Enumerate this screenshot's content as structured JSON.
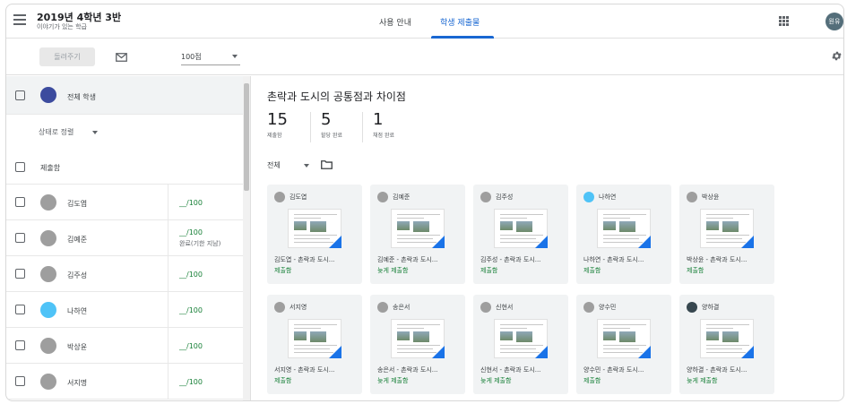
{
  "header": {
    "class_title": "2019년 4학년 3반",
    "class_subtitle": "이야기가 있는 학급",
    "tabs": [
      {
        "label": "사용 안내"
      },
      {
        "label": "학생 제출물"
      }
    ],
    "user_avatar": "원유"
  },
  "toolbar": {
    "return_label": "돌려주기",
    "points_value": "100점"
  },
  "left": {
    "all_students_label": "전체 학생",
    "sort_label": "상태로 정렬",
    "submitted_section_label": "제출함",
    "students": [
      {
        "name": "김도엽",
        "grade": "__/100",
        "note": ""
      },
      {
        "name": "김예준",
        "grade": "__/100",
        "note": "완료(기한 지남)"
      },
      {
        "name": "김주성",
        "grade": "__/100",
        "note": ""
      },
      {
        "name": "나하연",
        "grade": "__/100",
        "note": ""
      },
      {
        "name": "박상윤",
        "grade": "__/100",
        "note": ""
      },
      {
        "name": "서지명",
        "grade": "__/100",
        "note": ""
      }
    ]
  },
  "main": {
    "assignment_title": "촌락과 도시의 공통점과 차이점",
    "stats": [
      {
        "num": "15",
        "label": "제출함"
      },
      {
        "num": "5",
        "label": "할당 완료"
      },
      {
        "num": "1",
        "label": "채점 완료"
      }
    ],
    "filter_label": "전체",
    "cards": [
      {
        "name": "김도엽",
        "file": "김도엽 - 촌락과 도시...",
        "status": "제출함"
      },
      {
        "name": "김예준",
        "file": "김예준 - 촌락과 도시...",
        "status": "늦게 제출함"
      },
      {
        "name": "김주성",
        "file": "김주성 - 촌락과 도시...",
        "status": "제출함"
      },
      {
        "name": "나하연",
        "file": "나하연 - 촌락과 도시...",
        "status": "제출함"
      },
      {
        "name": "박상윤",
        "file": "박상윤 - 촌락과 도시...",
        "status": "제출함"
      },
      {
        "name": "서지영",
        "file": "서지영 - 촌락과 도시...",
        "status": "제출함"
      },
      {
        "name": "송은서",
        "file": "송은서 - 촌락과 도시...",
        "status": "늦게 제출함"
      },
      {
        "name": "신현서",
        "file": "신현서 - 촌락과 도시...",
        "status": "늦게 제출함"
      },
      {
        "name": "양수민",
        "file": "양수민 - 촌락과 도시...",
        "status": "제출함"
      },
      {
        "name": "양하결",
        "file": "양하결 - 촌락과 도시...",
        "status": "늦게 제출함"
      }
    ]
  },
  "colors": {
    "accent": "#1967d2",
    "status_green": "#188038"
  }
}
